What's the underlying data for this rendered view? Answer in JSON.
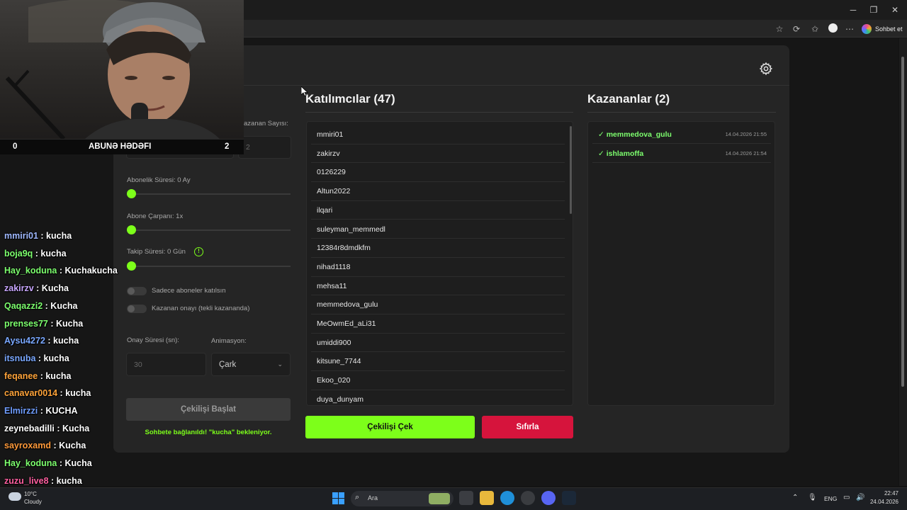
{
  "browser": {
    "copilot_label": "Sohbet et",
    "window_controls": [
      "minimize-icon",
      "restore-icon",
      "close-icon"
    ],
    "toolbar_icons": [
      "favorite-star-icon",
      "extensions-icon",
      "collections-icon",
      "profile-icon",
      "more-icon"
    ]
  },
  "stream": {
    "sub_goal": {
      "current": "0",
      "label": "ABUNƏ HƏDƏFI",
      "target": "2"
    },
    "chat": [
      {
        "user": "mmiri01",
        "msg": " : kucha",
        "color": "#9fb8ff"
      },
      {
        "user": "boja9q",
        "msg": " : kucha",
        "color": "#7dff6e"
      },
      {
        "user": "Hay_koduna",
        "msg": " : Kuchakucha",
        "color": "#7dff6e"
      },
      {
        "user": "zakirzv",
        "msg": " : Kucha",
        "color": "#c9a7ff"
      },
      {
        "user": "Qaqazzi2",
        "msg": " : Kucha",
        "color": "#7dff6e"
      },
      {
        "user": "prenses77",
        "msg": " : Kucha",
        "color": "#7dff6e"
      },
      {
        "user": "Aysu4272",
        "msg": " : kucha",
        "color": "#7aa8ff"
      },
      {
        "user": "itsnuba",
        "msg": " : kucha",
        "color": "#7aa8ff"
      },
      {
        "user": "feqanee",
        "msg": " : kucha",
        "color": "#ffa43a"
      },
      {
        "user": "canavar0014",
        "msg": " : kucha",
        "color": "#ffa43a"
      },
      {
        "user": "Elmirzzi",
        "msg": " : KUCHA",
        "color": "#6f9dff"
      },
      {
        "user": "zeynebadilli",
        "msg": " : Kucha",
        "color": "#ffffff"
      },
      {
        "user": "sayroxamd",
        "msg": " : Kucha",
        "color": "#ff9a3a"
      },
      {
        "user": "Hay_koduna",
        "msg": " : Kucha",
        "color": "#7dff6e"
      },
      {
        "user": "zuzu_live8",
        "msg": " : kucha",
        "color": "#ff5fa0"
      }
    ]
  },
  "settings": {
    "winner_count_label": "azanan Sayısı:",
    "winner_count_placeholder": "2",
    "sub_duration_label": "Abonelik Süresi: 0 Ay",
    "sub_multiplier_label": "Abone Çarpanı: 1x",
    "follow_duration_label": "Takip Süresi:  0  Gün",
    "subs_only_label": "Sadece aboneler katılsın",
    "winner_confirm_label": "Kazanan onayı (tekli kazananda)",
    "confirm_time_label": "Onay Süresi (sn):",
    "confirm_time_placeholder": "30",
    "animation_label": "Animasyon:",
    "animation_value": "Çark",
    "start_button": "Çekilişi Başlat",
    "status_text": "Sohbete bağlanıldı! \"kucha\" bekleniyor."
  },
  "participants": {
    "title": "Katılımcılar (47)",
    "items": [
      "mmiri01",
      "zakirzv",
      "0126229",
      "Altun2022",
      "ilqari",
      "suleyman_memmedl",
      "12384r8dmdkfm",
      "nihad1118",
      "mehsa11",
      "memmedova_gulu",
      "MeOwmEd_aLi31",
      "umiddi900",
      "kitsune_7744",
      "Ekoo_020",
      "duya_dunyam"
    ]
  },
  "winners": {
    "title": "Kazananlar (2)",
    "items": [
      {
        "name": "✓ memmedova_gulu",
        "time": "14.04.2026 21:55"
      },
      {
        "name": "✓ ishlamoffa",
        "time": "14.04.2026 21:54"
      }
    ]
  },
  "actions": {
    "draw": "Çekilişi Çek",
    "reset": "Sıfırla"
  },
  "colors": {
    "accent_green": "#7dff1a",
    "reset_red": "#d6143c",
    "card_bg": "#252525"
  },
  "taskbar": {
    "weather_temp": "10°C",
    "weather_desc": "Cloudy",
    "search_placeholder": "Ara",
    "lang": "ENG",
    "time": "22:47",
    "date": "24.04.2026"
  }
}
